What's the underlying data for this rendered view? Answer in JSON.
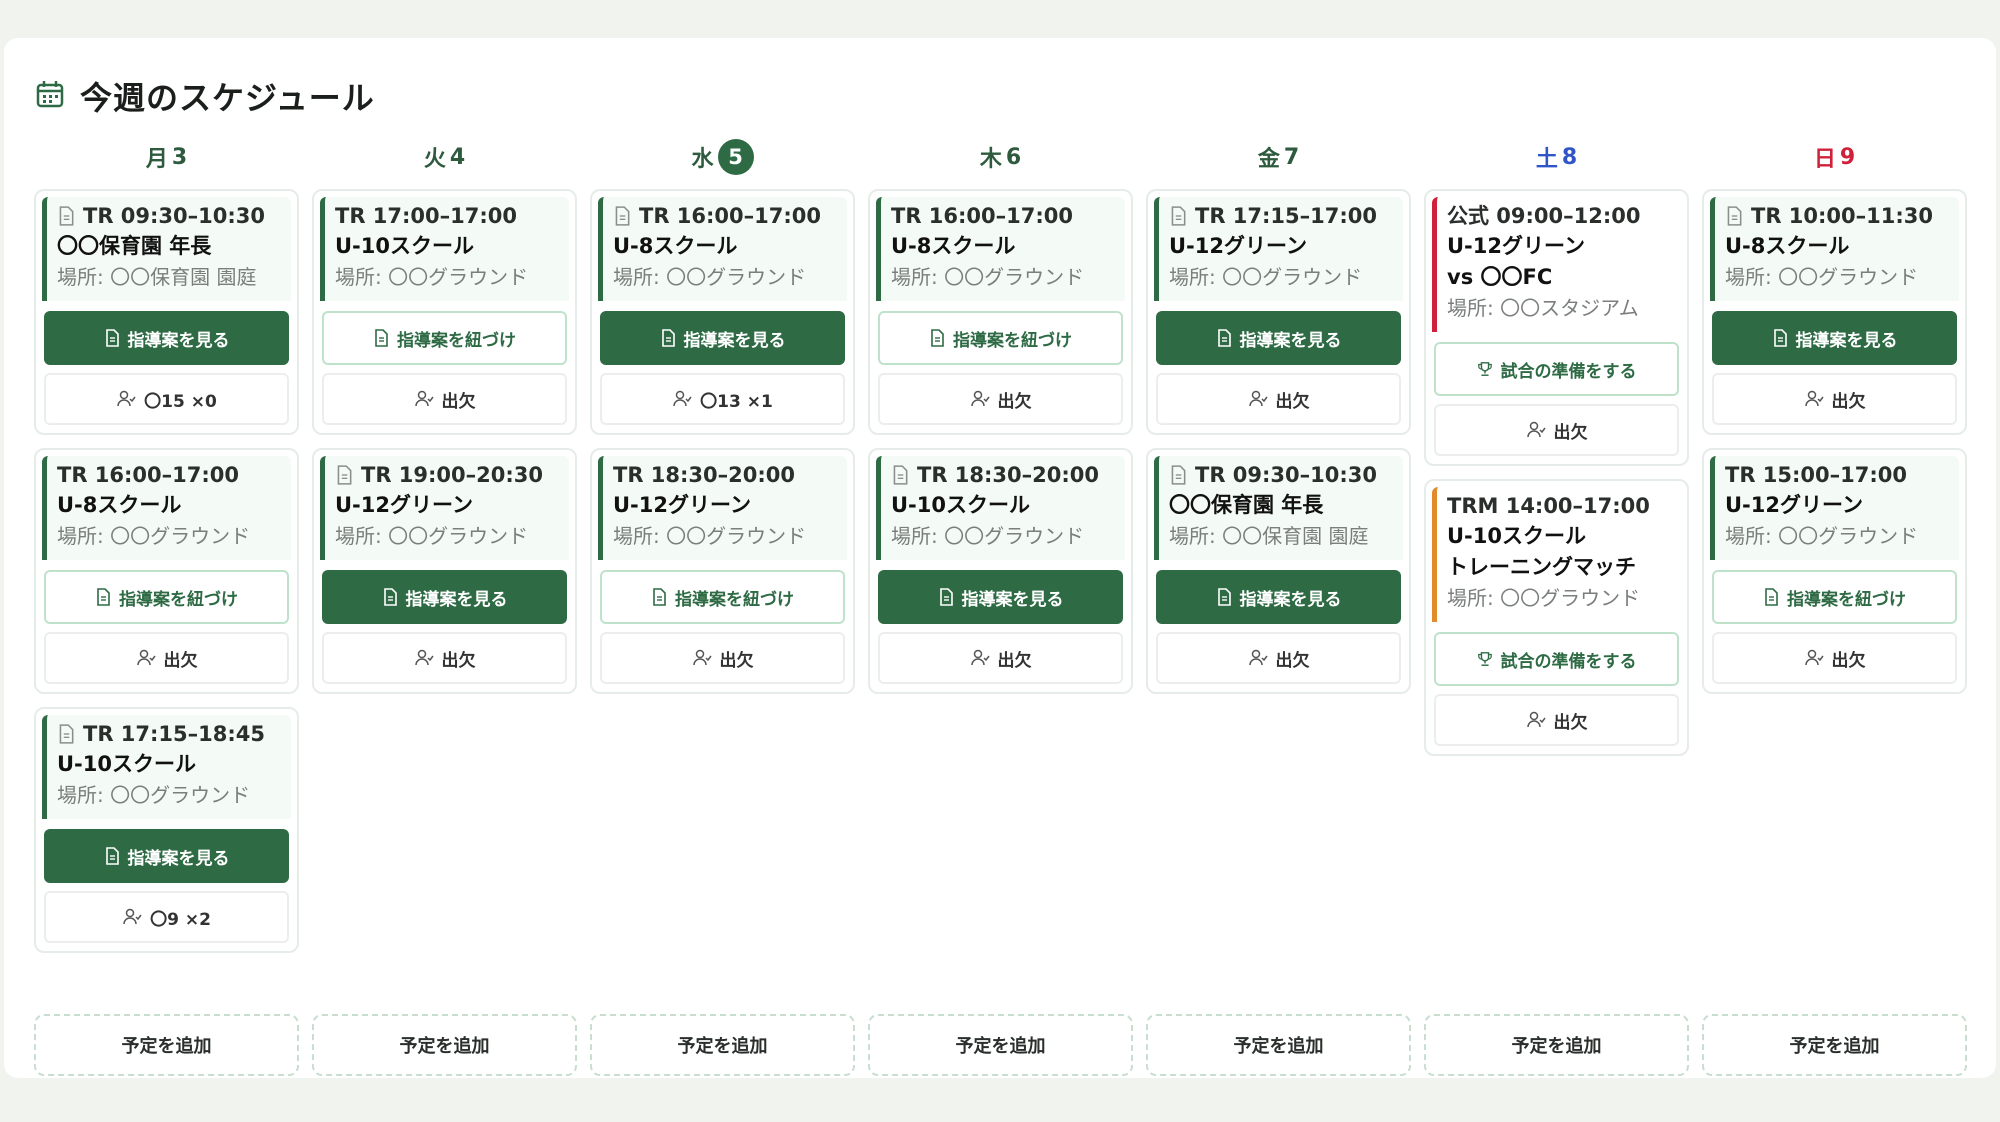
{
  "title": "今週のスケジュール",
  "colors": {
    "accent": "#2e6b45",
    "saturday": "#2f55c8",
    "sunday": "#d0213b",
    "match": "#d0213b",
    "trm": "#e08b2c"
  },
  "add_label": "予定を追加",
  "days": [
    {
      "label": "月",
      "date": "3",
      "events": [
        {
          "line1": "TR 09:30–10:30",
          "doc": true,
          "line2": "〇〇保育園 年長",
          "line3": "場所: 〇〇保育園 園庭",
          "button": {
            "style": "dark",
            "label": "指導案を見る",
            "icon": "doc-icon"
          },
          "attendance": "〇15 ×0"
        },
        {
          "line1": "TR 16:00–17:00",
          "doc": false,
          "line2": "U-8スクール",
          "line3": "場所: 〇〇グラウンド",
          "button": {
            "style": "outline",
            "label": "指導案を紐づけ",
            "icon": "doc-icon"
          },
          "attendance": "出欠"
        },
        {
          "line1": "TR 17:15–18:45",
          "doc": true,
          "line2": "U-10スクール",
          "line3": "場所: 〇〇グラウンド",
          "button": {
            "style": "dark",
            "label": "指導案を見る",
            "icon": "doc-icon"
          },
          "attendance": "〇9 ×2"
        }
      ]
    },
    {
      "label": "火",
      "date": "4",
      "events": [
        {
          "line1": "TR 17:00–17:00",
          "doc": false,
          "line2": "U-10スクール",
          "line3": "場所: 〇〇グラウンド",
          "button": {
            "style": "outline",
            "label": "指導案を紐づけ",
            "icon": "doc-icon"
          },
          "attendance": "出欠"
        },
        {
          "line1": "TR 19:00–20:30",
          "doc": true,
          "line2": "U-12グリーン",
          "line3": "場所: 〇〇グラウンド",
          "button": {
            "style": "dark",
            "label": "指導案を見る",
            "icon": "doc-icon"
          },
          "attendance": "出欠"
        }
      ]
    },
    {
      "label": "水",
      "date": "5",
      "today": true,
      "events": [
        {
          "line1": "TR 16:00–17:00",
          "doc": true,
          "line2": "U-8スクール",
          "line3": "場所: 〇〇グラウンド",
          "button": {
            "style": "dark",
            "label": "指導案を見る",
            "icon": "doc-icon"
          },
          "attendance": "〇13 ×1"
        },
        {
          "line1": "TR 18:30–20:00",
          "doc": false,
          "line2": "U-12グリーン",
          "line3": "場所: 〇〇グラウンド",
          "button": {
            "style": "outline",
            "label": "指導案を紐づけ",
            "icon": "doc-icon"
          },
          "attendance": "出欠"
        }
      ]
    },
    {
      "label": "木",
      "date": "6",
      "events": [
        {
          "line1": "TR 16:00–17:00",
          "doc": false,
          "line2": "U-8スクール",
          "line3": "場所: 〇〇グラウンド",
          "button": {
            "style": "outline",
            "label": "指導案を紐づけ",
            "icon": "doc-icon"
          },
          "attendance": "出欠"
        },
        {
          "line1": "TR 18:30–20:00",
          "doc": true,
          "line2": "U-10スクール",
          "line3": "場所: 〇〇グラウンド",
          "button": {
            "style": "dark",
            "label": "指導案を見る",
            "icon": "doc-icon"
          },
          "attendance": "出欠"
        }
      ]
    },
    {
      "label": "金",
      "date": "7",
      "events": [
        {
          "line1": "TR 17:15–17:00",
          "doc": true,
          "line2": "U-12グリーン",
          "line3": "場所: 〇〇グラウンド",
          "button": {
            "style": "dark",
            "label": "指導案を見る",
            "icon": "doc-icon"
          },
          "attendance": "出欠"
        },
        {
          "line1": "TR 09:30–10:30",
          "doc": true,
          "line2": "〇〇保育園 年長",
          "line3": "場所: 〇〇保育園 園庭",
          "button": {
            "style": "dark",
            "label": "指導案を見る",
            "icon": "doc-icon"
          },
          "attendance": "出欠"
        }
      ]
    },
    {
      "label": "土",
      "date": "8",
      "tone": "sat",
      "events": [
        {
          "line1": "公式 09:00–12:00",
          "doc": false,
          "border": "red",
          "line2": "U-12グリーン",
          "line2b": "vs 〇〇FC",
          "line3": "場所: 〇〇スタジアム",
          "button": {
            "style": "outline",
            "label": "試合の準備をする",
            "icon": "trophy-icon"
          },
          "attendance": "出欠"
        },
        {
          "line1": "TRM 14:00–17:00",
          "doc": false,
          "border": "orange",
          "line2": "U-10スクール",
          "line2b": "トレーニングマッチ",
          "line3": "場所: 〇〇グラウンド",
          "button": {
            "style": "outline",
            "label": "試合の準備をする",
            "icon": "trophy-icon"
          },
          "attendance": "出欠"
        }
      ]
    },
    {
      "label": "日",
      "date": "9",
      "tone": "sun",
      "events": [
        {
          "line1": "TR 10:00–11:30",
          "doc": true,
          "line2": "U-8スクール",
          "line3": "場所: 〇〇グラウンド",
          "button": {
            "style": "dark",
            "label": "指導案を見る",
            "icon": "doc-icon"
          },
          "attendance": "出欠"
        },
        {
          "line1": "TR 15:00–17:00",
          "doc": false,
          "line2": "U-12グリーン",
          "line3": "場所: 〇〇グラウンド",
          "button": {
            "style": "outline",
            "label": "指導案を紐づけ",
            "icon": "doc-icon"
          },
          "attendance": "出欠"
        }
      ]
    }
  ]
}
